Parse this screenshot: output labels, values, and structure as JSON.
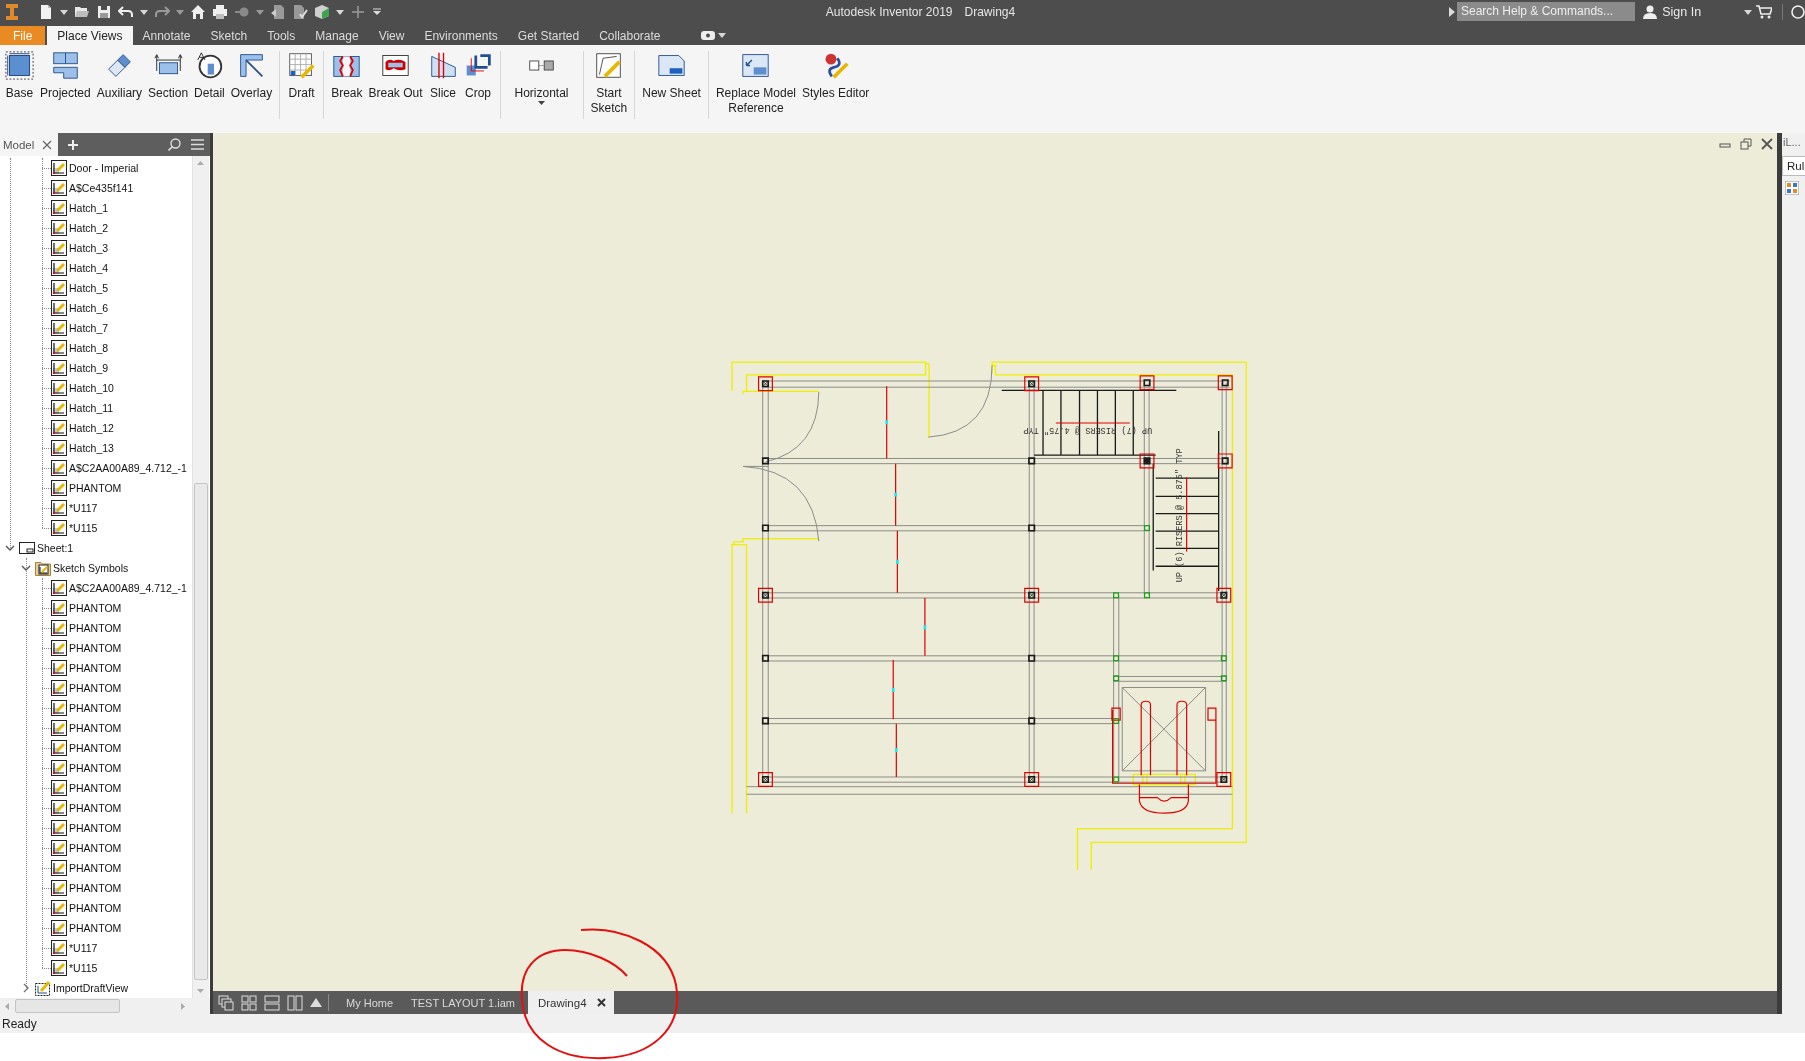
{
  "title_bar": {
    "app_title": "Autodesk Inventor 2019",
    "document": "Drawing4",
    "search": {
      "placeholder": "Search Help & Commands..."
    },
    "sign_in": "Sign In"
  },
  "ribbon_tabs": [
    {
      "label": "File",
      "kind": "menu",
      "selected": false
    },
    {
      "label": "Place Views",
      "kind": "tab",
      "selected": true
    },
    {
      "label": "Annotate",
      "kind": "tab",
      "selected": false
    },
    {
      "label": "Sketch",
      "kind": "tab",
      "selected": false
    },
    {
      "label": "Tools",
      "kind": "tab",
      "selected": false
    },
    {
      "label": "Manage",
      "kind": "tab",
      "selected": false
    },
    {
      "label": "View",
      "kind": "tab",
      "selected": false
    },
    {
      "label": "Environments",
      "kind": "tab",
      "selected": false
    },
    {
      "label": "Get Started",
      "kind": "tab",
      "selected": false
    },
    {
      "label": "Collaborate",
      "kind": "tab",
      "selected": false
    }
  ],
  "ribbon": {
    "groups": [
      {
        "buttons": [
          {
            "label": "Base",
            "dropdown": false
          },
          {
            "label": "Projected",
            "dropdown": false
          },
          {
            "label": "Auxiliary",
            "dropdown": false
          },
          {
            "label": "Section",
            "dropdown": false
          },
          {
            "label": "Detail",
            "dropdown": false
          },
          {
            "label": "Overlay",
            "dropdown": false
          }
        ]
      },
      {
        "buttons": [
          {
            "label": "Draft",
            "dropdown": false
          }
        ]
      },
      {
        "buttons": [
          {
            "label": "Break",
            "dropdown": false
          },
          {
            "label": "Break Out",
            "dropdown": false
          },
          {
            "label": "Slice",
            "dropdown": false
          },
          {
            "label": "Crop",
            "dropdown": false
          }
        ]
      },
      {
        "buttons": [
          {
            "label": "Horizontal",
            "dropdown": true
          }
        ]
      },
      {
        "buttons": [
          {
            "label": "Start\nSketch",
            "dropdown": false
          }
        ]
      },
      {
        "buttons": [
          {
            "label": "New Sheet",
            "dropdown": false
          }
        ]
      },
      {
        "buttons": [
          {
            "label": "Replace Model\nReference",
            "dropdown": false
          },
          {
            "label": "Styles Editor",
            "dropdown": false
          }
        ]
      }
    ]
  },
  "browser": {
    "tab": "Model",
    "tree": [
      {
        "children": [
          {
            "children": [
              {
                "label": "Door - Imperial",
                "kind": "sketch"
              },
              {
                "label": "A$Ce435f141",
                "kind": "sketch"
              },
              {
                "label": "Hatch_1",
                "kind": "sketch"
              },
              {
                "label": "Hatch_2",
                "kind": "sketch"
              },
              {
                "label": "Hatch_3",
                "kind": "sketch"
              },
              {
                "label": "Hatch_4",
                "kind": "sketch"
              },
              {
                "label": "Hatch_5",
                "kind": "sketch"
              },
              {
                "label": "Hatch_6",
                "kind": "sketch"
              },
              {
                "label": "Hatch_7",
                "kind": "sketch"
              },
              {
                "label": "Hatch_8",
                "kind": "sketch"
              },
              {
                "label": "Hatch_9",
                "kind": "sketch"
              },
              {
                "label": "Hatch_10",
                "kind": "sketch"
              },
              {
                "label": "Hatch_11",
                "kind": "sketch"
              },
              {
                "label": "Hatch_12",
                "kind": "sketch"
              },
              {
                "label": "Hatch_13",
                "kind": "sketch"
              },
              {
                "label": "A$C2AA00A89_4.712_-1",
                "kind": "sketch"
              },
              {
                "label": "PHANTOM",
                "kind": "sketch"
              },
              {
                "label": "*U117",
                "kind": "sketch"
              },
              {
                "label": "*U115",
                "kind": "sketch"
              }
            ]
          }
        ]
      },
      {
        "label": "Sheet:1",
        "kind": "sheet",
        "expanded": true,
        "children": [
          {
            "label": "Sketch Symbols",
            "kind": "folder",
            "expanded": true,
            "children": [
              {
                "label": "A$C2AA00A89_4.712_-1",
                "kind": "sketch"
              },
              {
                "label": "PHANTOM",
                "kind": "sketch"
              },
              {
                "label": "PHANTOM",
                "kind": "sketch"
              },
              {
                "label": "PHANTOM",
                "kind": "sketch"
              },
              {
                "label": "PHANTOM",
                "kind": "sketch"
              },
              {
                "label": "PHANTOM",
                "kind": "sketch"
              },
              {
                "label": "PHANTOM",
                "kind": "sketch"
              },
              {
                "label": "PHANTOM",
                "kind": "sketch"
              },
              {
                "label": "PHANTOM",
                "kind": "sketch"
              },
              {
                "label": "PHANTOM",
                "kind": "sketch"
              },
              {
                "label": "PHANTOM",
                "kind": "sketch"
              },
              {
                "label": "PHANTOM",
                "kind": "sketch"
              },
              {
                "label": "PHANTOM",
                "kind": "sketch"
              },
              {
                "label": "PHANTOM",
                "kind": "sketch"
              },
              {
                "label": "PHANTOM",
                "kind": "sketch"
              },
              {
                "label": "PHANTOM",
                "kind": "sketch"
              },
              {
                "label": "PHANTOM",
                "kind": "sketch"
              },
              {
                "label": "PHANTOM",
                "kind": "sketch"
              },
              {
                "label": "*U117",
                "kind": "sketch"
              },
              {
                "label": "*U115",
                "kind": "sketch"
              }
            ]
          },
          {
            "label": "ImportDraftView",
            "kind": "draft_view",
            "expanded": false
          }
        ]
      }
    ]
  },
  "canvas": {
    "drawing_notes": [
      "UP (7) RISERS @ 4.75\" TYP",
      "UP (6) RISERS @ 5.875\" TYP"
    ]
  },
  "right_panel": {
    "title": "iL...",
    "tab": "Rul"
  },
  "document_tabs": [
    {
      "label": "My Home",
      "selected": false
    },
    {
      "label": "TEST LAYOUT 1.iam",
      "selected": false
    },
    {
      "label": "Drawing4",
      "selected": true
    }
  ],
  "status_bar": {
    "text": "Ready"
  }
}
